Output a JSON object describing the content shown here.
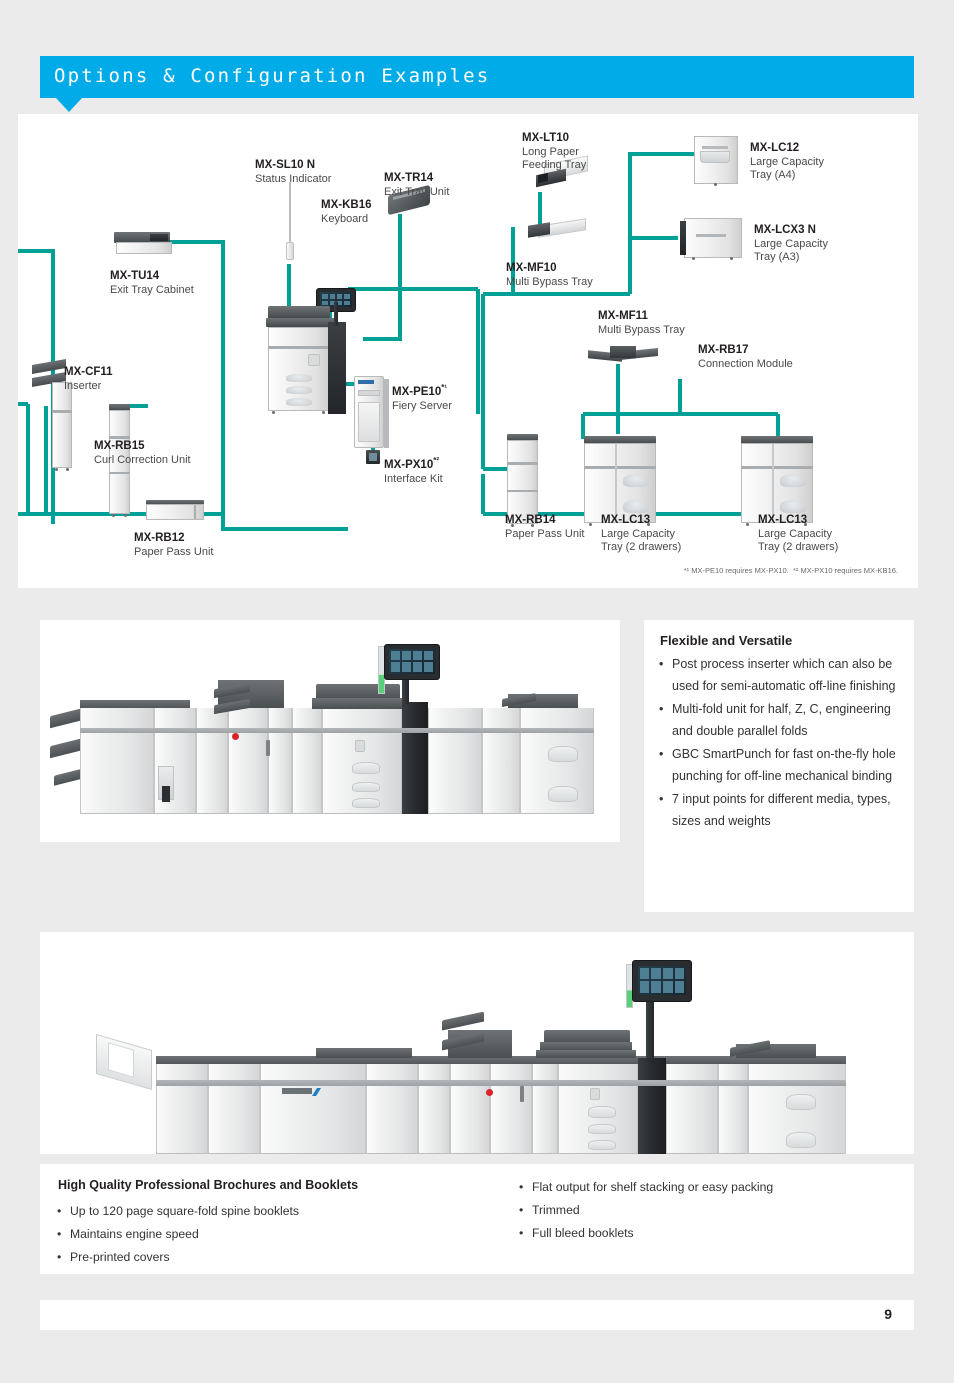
{
  "header": {
    "title": "Options & Configuration Examples",
    "accent_color": "#00abe8"
  },
  "page": {
    "background_color": "#ebebeb",
    "panel_color": "#ffffff",
    "number": "9"
  },
  "diagram": {
    "connector_color": "#00a096",
    "footnote_1": "*¹ MX-PE10 requires MX-PX10.",
    "footnote_2": "*² MX-PX10 requires MX-KB16.",
    "nodes": [
      {
        "id": "mx-sl10n",
        "code": "MX-SL10 N",
        "desc": "Status Indicator"
      },
      {
        "id": "mx-tr14",
        "code": "MX-TR14",
        "desc": "Exit Tray Unit"
      },
      {
        "id": "mx-kb16",
        "code": "MX-KB16",
        "desc": "Keyboard"
      },
      {
        "id": "mx-lt10",
        "code": "MX-LT10",
        "desc": "Long Paper",
        "desc2": "Feeding Tray"
      },
      {
        "id": "mx-lc12",
        "code": "MX-LC12",
        "desc": "Large Capacity",
        "desc2": "Tray (A4)"
      },
      {
        "id": "mx-lcx3n",
        "code": "MX-LCX3 N",
        "desc": "Large Capacity",
        "desc2": "Tray (A3)"
      },
      {
        "id": "mx-mf10",
        "code": "MX-MF10",
        "desc": "Multi Bypass Tray"
      },
      {
        "id": "mx-mf11",
        "code": "MX-MF11",
        "desc": "Multi Bypass Tray"
      },
      {
        "id": "mx-rb17",
        "code": "MX-RB17",
        "desc": "Connection Module"
      },
      {
        "id": "mx-tu14",
        "code": "MX-TU14",
        "desc": "Exit Tray Cabinet"
      },
      {
        "id": "mx-cf11",
        "code": "MX-CF11",
        "desc": "Inserter"
      },
      {
        "id": "mx-rb15",
        "code": "MX-RB15",
        "desc": "Curl Correction Unit"
      },
      {
        "id": "mx-rb12",
        "code": "MX-RB12",
        "desc": "Paper Pass Unit"
      },
      {
        "id": "mx-pe10",
        "code": "MX-PE10",
        "sup": "*¹",
        "desc": "Fiery Server"
      },
      {
        "id": "mx-px10",
        "code": "MX-PX10",
        "sup": "*²",
        "desc": "Interface Kit"
      },
      {
        "id": "mx-rb14",
        "code": "MX-RB14",
        "desc": "Paper Pass Unit"
      },
      {
        "id": "mx-lc13a",
        "code": "MX-LC13",
        "desc": "Large Capacity",
        "desc2": "Tray (2 drawers)"
      },
      {
        "id": "mx-lc13b",
        "code": "MX-LC13",
        "desc": "Large Capacity",
        "desc2": "Tray (2 drawers)"
      }
    ]
  },
  "features": {
    "title": "Flexible and Versatile",
    "items": [
      "Post process inserter which can also be used for semi-automatic off-line finishing",
      "Multi-fold unit for half, Z, C, engineering and double parallel folds",
      "GBC SmartPunch for fast on-the-fly hole punching for off-line mechanical binding",
      "7 input points for different media, types, sizes and weights"
    ]
  },
  "booklets": {
    "title": "High Quality Professional Brochures and Booklets",
    "left_items": [
      "Up to 120 page square-fold spine booklets",
      "Maintains engine speed",
      "Pre-printed covers"
    ],
    "right_items": [
      "Flat output for shelf stacking or easy packing",
      "Trimmed",
      "Full bleed booklets"
    ]
  },
  "photos": {
    "photo1_caption": "",
    "photo2_caption": ""
  }
}
